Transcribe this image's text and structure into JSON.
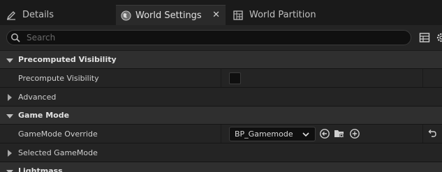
{
  "tabs": [
    {
      "label": "Details",
      "icon": "pencil-icon"
    },
    {
      "label": "World Settings",
      "icon": "globe-icon",
      "close": "✕"
    },
    {
      "label": "World Partition",
      "icon": "grid-icon"
    }
  ],
  "search": {
    "placeholder": "Search"
  },
  "sections": {
    "precomputed_visibility": {
      "title": "Precomputed Visibility",
      "precompute_label": "Precompute Visibility",
      "precompute_checked": false,
      "advanced_label": "Advanced"
    },
    "game_mode": {
      "title": "Game Mode",
      "override_label": "GameMode Override",
      "override_value": "BP_Gamemode",
      "selected_label": "Selected GameMode"
    },
    "lightmass": {
      "title": "Lightmass"
    }
  },
  "colors": {
    "panel": "#242424",
    "category": "#2f2f2f",
    "background": "#1a1a1a"
  }
}
